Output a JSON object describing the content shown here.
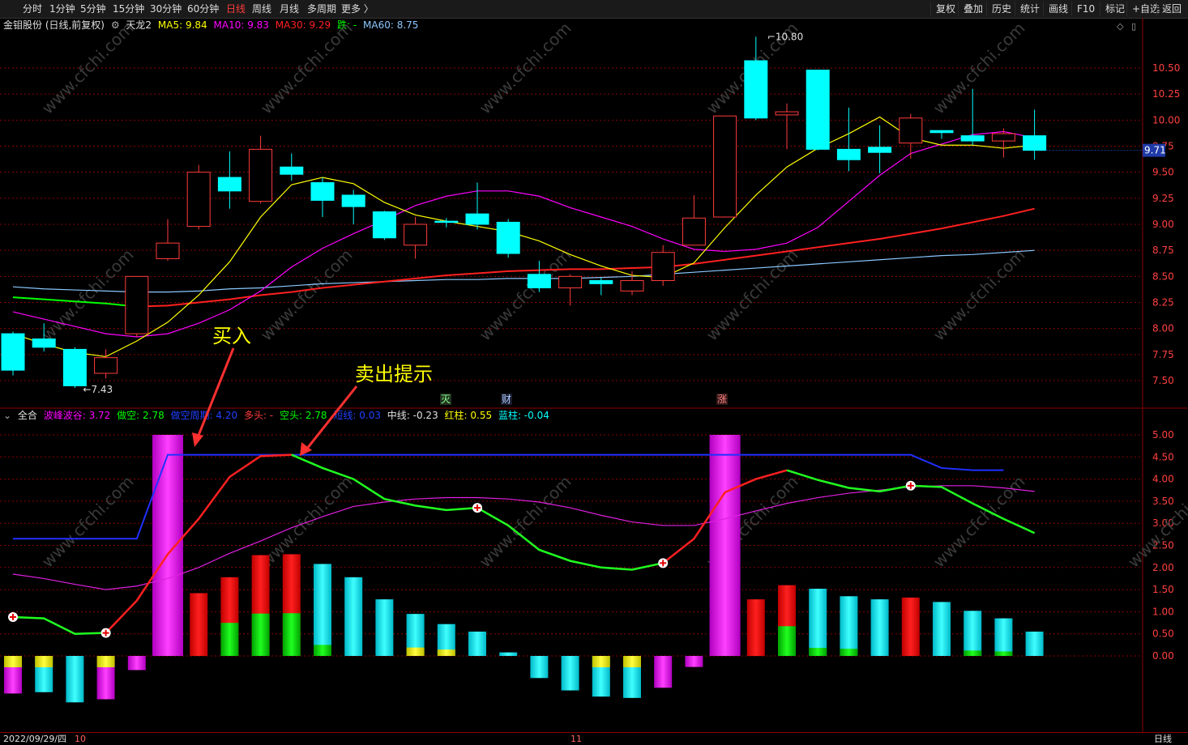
{
  "toolbar": {
    "periods": [
      "分时",
      "1分钟",
      "5分钟",
      "15分钟",
      "30分钟",
      "60分钟",
      "日线",
      "周线",
      "月线",
      "多周期",
      "更多 〉"
    ],
    "active_period": "日线",
    "right_buttons": [
      "复权",
      "叠加",
      "历史",
      "统计",
      "画线",
      "F10",
      "标记",
      "+自选",
      "返回"
    ]
  },
  "main_info": {
    "stock": "金钼股份 (日线,前复权)",
    "indicator": "天龙2",
    "ma5": "MA5: 9.84",
    "ma10": "MA10: 9.83",
    "ma30": "MA30: 9.29",
    "die": "跌: -",
    "ma60": "MA60: 8.75"
  },
  "sub_info": {
    "name": "全合",
    "bofeng": "波峰波谷: 3.72",
    "zuokong": "做空: 2.78",
    "hidden": "做空周期: 4.20",
    "duotou": "多头: -",
    "kongtou": "空头: 2.78",
    "duanxian": "短线: 0.03",
    "zhongxian": "中线: -0.23",
    "hongzhu": "红柱: 0.55",
    "lanzhu": "蓝柱: -0.04"
  },
  "markers": {
    "mie": "灭",
    "cai": "财",
    "zhang": "涨"
  },
  "annotations": {
    "buy": "买入",
    "sell": "卖出提示"
  },
  "bottom": {
    "date": "2022/09/29/四",
    "m10": "10",
    "m11": "11",
    "period": "日线"
  },
  "price_tag": "9.71",
  "watermark": "www.cfchi.com",
  "colors": {
    "up": "#ff3b3b",
    "down": "#00ffff",
    "ma5": "#ffff00",
    "ma10": "#ff00ff",
    "ma30": "#ff2020",
    "ma60": "#8cc8ff",
    "grid": "#8b0000",
    "axis": "#ff4040"
  },
  "chart_data": {
    "type": "candlestick",
    "price_axis": {
      "min": 7.5,
      "max": 10.5,
      "ticks": [
        "10.50",
        "10.25",
        "10.00",
        "9.75",
        "9.50",
        "9.25",
        "9.00",
        "8.75",
        "8.50",
        "8.25",
        "8.00",
        "7.75",
        "7.50"
      ]
    },
    "sub_axis": {
      "min": 0,
      "max": 5,
      "ticks": [
        "5.00",
        "4.50",
        "4.00",
        "3.50",
        "3.00",
        "2.50",
        "2.00",
        "1.50",
        "1.00",
        "0.50",
        "0.00"
      ]
    },
    "high_label": "10.80",
    "low_label": "7.43",
    "candles": [
      [
        7.95,
        7.6,
        7.97,
        7.55
      ],
      [
        7.9,
        7.82,
        8.05,
        7.78
      ],
      [
        7.8,
        7.45,
        7.82,
        7.43
      ],
      [
        7.57,
        7.72,
        7.8,
        7.52
      ],
      [
        7.95,
        8.5,
        8.5,
        7.92
      ],
      [
        8.67,
        8.82,
        9.05,
        8.65
      ],
      [
        8.98,
        9.5,
        9.57,
        8.95
      ],
      [
        9.45,
        9.32,
        9.7,
        9.15
      ],
      [
        9.22,
        9.72,
        9.85,
        9.2
      ],
      [
        9.55,
        9.48,
        9.68,
        9.42
      ],
      [
        9.4,
        9.23,
        9.45,
        9.07
      ],
      [
        9.28,
        9.17,
        9.33,
        9.0
      ],
      [
        9.12,
        8.87,
        9.13,
        8.85
      ],
      [
        8.8,
        9.0,
        9.07,
        8.67
      ],
      [
        9.03,
        9.02,
        9.06,
        8.97
      ],
      [
        9.1,
        9.0,
        9.4,
        8.95
      ],
      [
        9.02,
        8.72,
        9.05,
        8.68
      ],
      [
        8.52,
        8.39,
        8.65,
        8.35
      ],
      [
        8.39,
        8.5,
        8.52,
        8.22
      ],
      [
        8.46,
        8.43,
        8.49,
        8.32
      ],
      [
        8.36,
        8.46,
        8.55,
        8.32
      ],
      [
        8.46,
        8.73,
        8.8,
        8.41
      ],
      [
        8.8,
        9.06,
        9.28,
        8.8
      ],
      [
        9.07,
        10.04,
        10.04,
        9.07
      ],
      [
        10.57,
        10.02,
        10.8,
        10.0
      ],
      [
        10.05,
        10.08,
        10.16,
        9.72
      ],
      [
        10.48,
        9.72,
        10.48,
        9.71
      ],
      [
        9.72,
        9.62,
        10.12,
        9.51
      ],
      [
        9.74,
        9.69,
        9.95,
        9.49
      ],
      [
        9.78,
        10.02,
        10.06,
        9.63
      ],
      [
        9.9,
        9.88,
        9.9,
        9.82
      ],
      [
        9.85,
        9.8,
        10.3,
        9.76
      ],
      [
        9.8,
        9.87,
        9.92,
        9.64
      ],
      [
        9.85,
        9.71,
        10.1,
        9.62
      ]
    ],
    "ma5": [
      7.95,
      7.85,
      7.77,
      7.73,
      7.88,
      8.06,
      8.32,
      8.64,
      9.07,
      9.38,
      9.45,
      9.39,
      9.21,
      9.09,
      9.03,
      8.98,
      8.93,
      8.84,
      8.71,
      8.6,
      8.51,
      8.49,
      8.63,
      8.97,
      9.28,
      9.55,
      9.73,
      9.87,
      10.03,
      9.83,
      9.76,
      9.76,
      9.73,
      9.76
    ],
    "ma10": [
      8.16,
      8.09,
      8.02,
      7.95,
      7.92,
      7.95,
      8.05,
      8.18,
      8.36,
      8.59,
      8.77,
      8.91,
      9.04,
      9.18,
      9.27,
      9.32,
      9.32,
      9.27,
      9.16,
      9.07,
      8.98,
      8.86,
      8.76,
      8.74,
      8.76,
      8.82,
      8.97,
      9.22,
      9.47,
      9.68,
      9.77,
      9.86,
      9.89,
      9.83
    ],
    "ma30": [
      8.3,
      8.28,
      8.26,
      8.24,
      8.21,
      8.22,
      8.25,
      8.28,
      8.32,
      8.35,
      8.39,
      8.42,
      8.45,
      8.48,
      8.51,
      8.53,
      8.55,
      8.56,
      8.57,
      8.57,
      8.58,
      8.59,
      8.62,
      8.66,
      8.7,
      8.74,
      8.78,
      8.82,
      8.86,
      8.91,
      8.96,
      9.02,
      9.08,
      9.15,
      9.22,
      9.29
    ],
    "ma60": [
      8.4,
      8.38,
      8.37,
      8.36,
      8.35,
      8.35,
      8.36,
      8.38,
      8.39,
      8.41,
      8.43,
      8.44,
      8.45,
      8.46,
      8.47,
      8.47,
      8.48,
      8.48,
      8.48,
      8.49,
      8.5,
      8.52,
      8.54,
      8.56,
      8.58,
      8.6,
      8.62,
      8.64,
      8.66,
      8.68,
      8.7,
      8.71,
      8.73,
      8.75
    ],
    "sub_series": {
      "blue": [
        2.65,
        2.65,
        2.65,
        2.65,
        2.65,
        4.55,
        4.55,
        4.55,
        4.55,
        4.55,
        4.55,
        4.55,
        4.55,
        4.55,
        4.55,
        4.55,
        4.55,
        4.55,
        4.55,
        4.55,
        4.55,
        4.55,
        4.55,
        4.55,
        4.55,
        4.55,
        4.55,
        4.55,
        4.55,
        4.55,
        4.25,
        4.2,
        4.2
      ],
      "magenta": [
        1.85,
        1.75,
        1.62,
        1.5,
        1.58,
        1.75,
        2.0,
        2.32,
        2.6,
        2.9,
        3.15,
        3.38,
        3.48,
        3.55,
        3.58,
        3.58,
        3.55,
        3.48,
        3.35,
        3.18,
        3.03,
        2.95,
        2.95,
        3.1,
        3.28,
        3.45,
        3.58,
        3.68,
        3.75,
        3.82,
        3.85,
        3.85,
        3.8,
        3.72
      ],
      "fast": [
        0.88,
        0.85,
        0.5,
        0.52,
        1.25,
        2.3,
        3.1,
        4.05,
        4.52,
        4.55,
        4.25,
        4.0,
        3.55,
        3.4,
        3.3,
        3.35,
        2.95,
        2.4,
        2.15,
        2.0,
        1.95,
        2.1,
        2.65,
        3.7,
        4.0,
        4.2,
        3.98,
        3.8,
        3.72,
        3.85,
        3.82,
        3.45,
        3.1,
        2.78
      ],
      "fast_green_from": 8,
      "bars": [
        {
          "v": -0.85,
          "c": "mixY"
        },
        {
          "v": -0.82,
          "c": "cyanY"
        },
        {
          "v": -1.05,
          "c": "cyan"
        },
        {
          "v": -0.98,
          "c": "magY"
        },
        {
          "v": -0.32,
          "c": "mag"
        },
        {
          "v": 5.0,
          "c": "bigmag"
        },
        {
          "v": 1.42,
          "c": "red"
        },
        {
          "v": 1.78,
          "c": "redgreen"
        },
        {
          "v": 2.28,
          "c": "redgreen"
        },
        {
          "v": 2.3,
          "c": "redgreen"
        },
        {
          "v": 2.08,
          "c": "cyangreen"
        },
        {
          "v": 1.78,
          "c": "cyan"
        },
        {
          "v": 1.28,
          "c": "cyan"
        },
        {
          "v": 0.95,
          "c": "cyanY"
        },
        {
          "v": 0.72,
          "c": "cyanY"
        },
        {
          "v": 0.55,
          "c": "cyan"
        },
        {
          "v": 0.08,
          "c": "cyan"
        },
        {
          "v": -0.5,
          "c": "cyan"
        },
        {
          "v": -0.78,
          "c": "cyan"
        },
        {
          "v": -0.92,
          "c": "cyanY"
        },
        {
          "v": -0.95,
          "c": "cyanY"
        },
        {
          "v": -0.72,
          "c": "mag"
        },
        {
          "v": -0.25,
          "c": "mag"
        },
        {
          "v": 5.0,
          "c": "bigmag"
        },
        {
          "v": 1.28,
          "c": "red"
        },
        {
          "v": 1.6,
          "c": "redgreen"
        },
        {
          "v": 1.52,
          "c": "cyangreen"
        },
        {
          "v": 1.35,
          "c": "cyangreen"
        },
        {
          "v": 1.28,
          "c": "cyan"
        },
        {
          "v": 1.32,
          "c": "red"
        },
        {
          "v": 1.22,
          "c": "cyan"
        },
        {
          "v": 1.02,
          "c": "cyangreen"
        },
        {
          "v": 0.85,
          "c": "cyangreen"
        },
        {
          "v": 0.55,
          "c": "cyan"
        }
      ],
      "signals": [
        0,
        3,
        15,
        21,
        29
      ]
    }
  }
}
